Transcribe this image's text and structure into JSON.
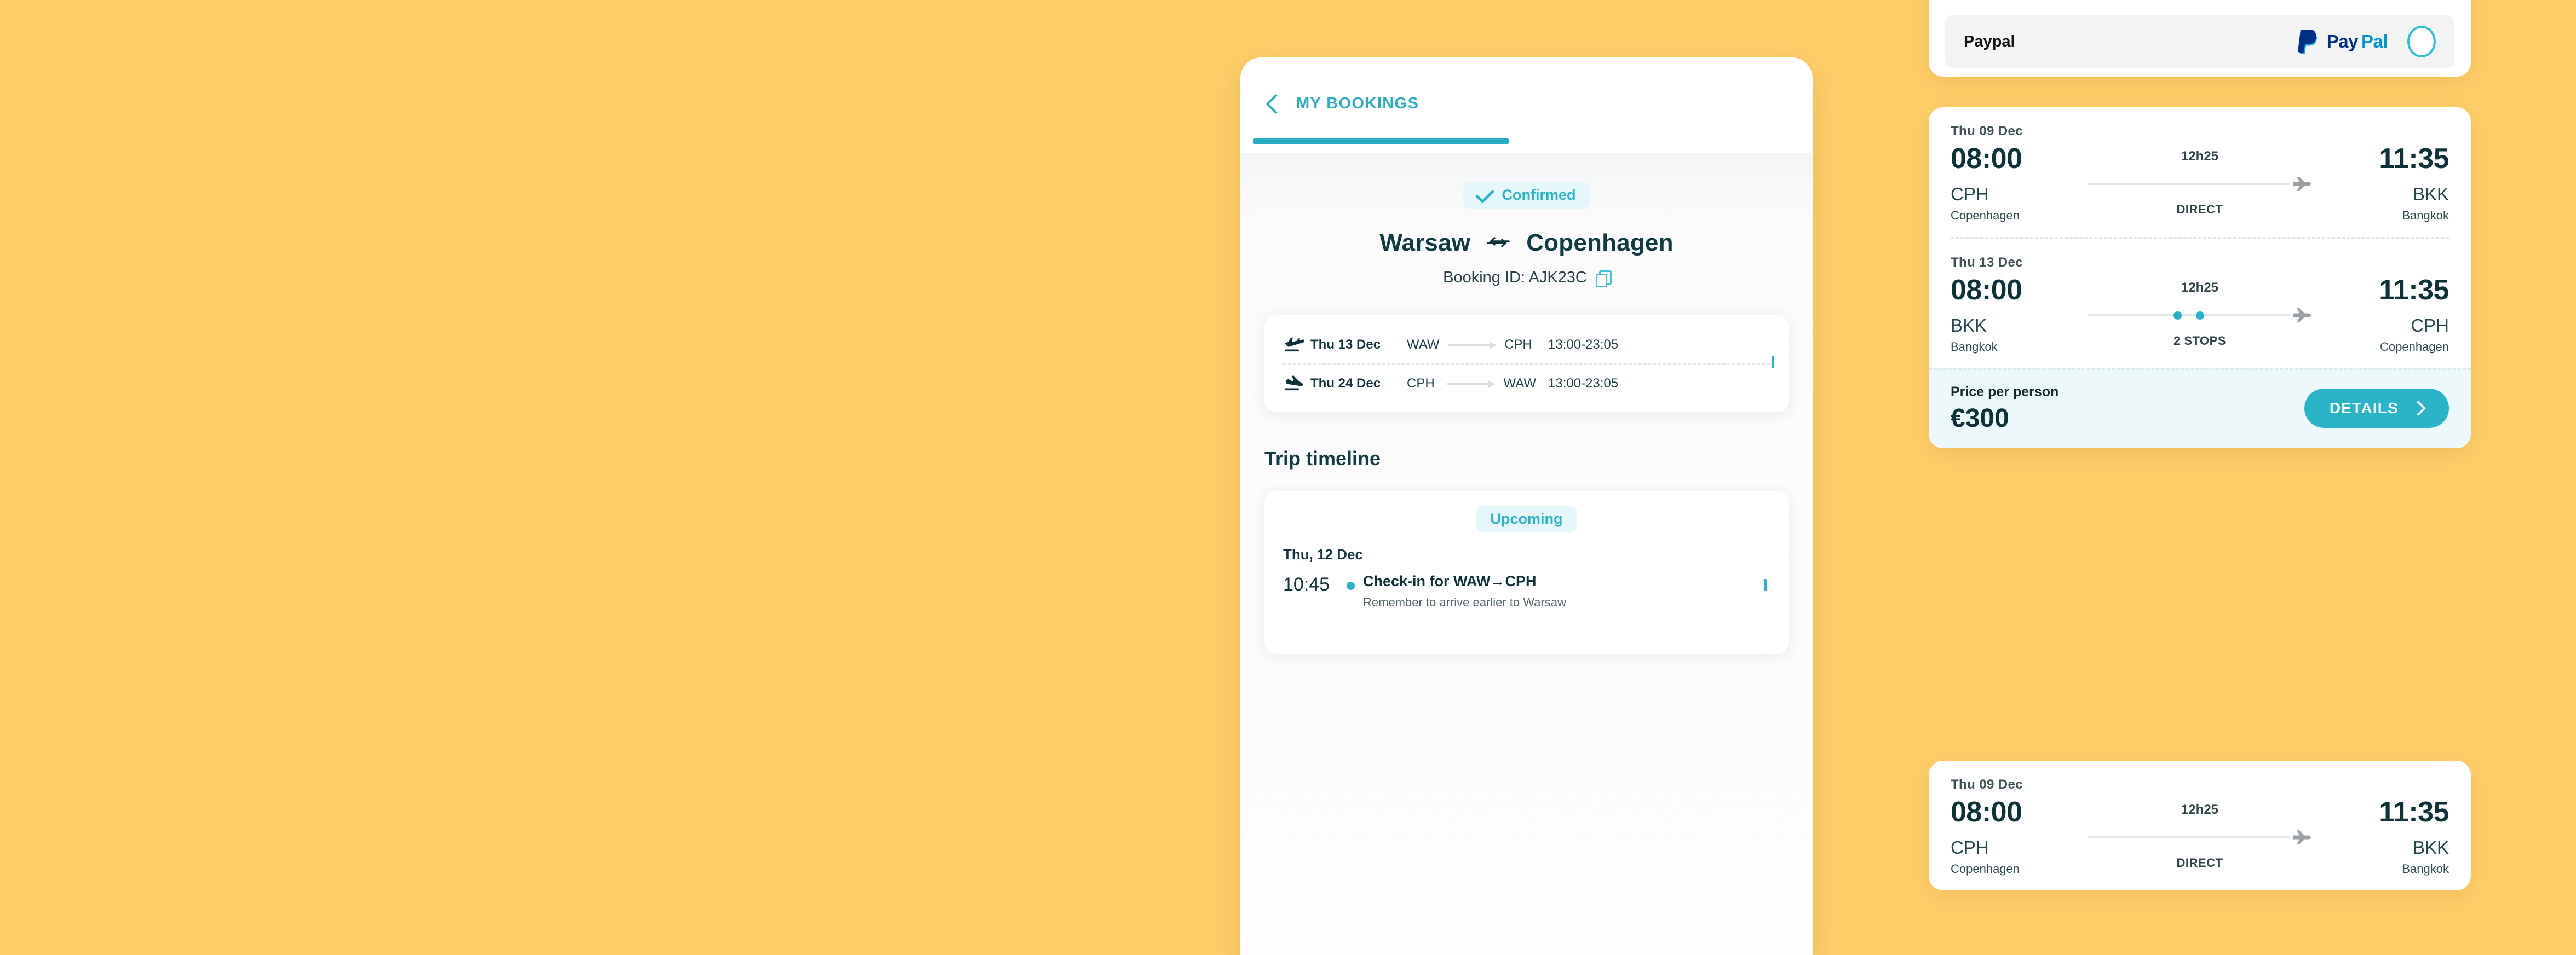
{
  "theme": {
    "background": "#FFCE69",
    "accent_teal": "#29B2C8",
    "dark_text": "#0E3238",
    "pill_bg": "#E6F7FB",
    "price_bar_bg": "#EDF8FA"
  },
  "phone": {
    "header": {
      "back_icon": "chevron-left-icon",
      "title": "MY BOOKINGS"
    },
    "booking": {
      "status_icon": "check-icon",
      "status_label": "Confirmed",
      "origin_city": "Warsaw",
      "swap_icon": "swap-arrows-icon",
      "destination_city": "Copenhagen",
      "booking_id_label": "Booking ID: AJK23C",
      "copy_icon": "copy-icon"
    },
    "legs": [
      {
        "icon": "takeoff-icon",
        "date": "Thu 13 Dec",
        "from": "WAW",
        "to": "CPH",
        "time": "13:00-23:05"
      },
      {
        "icon": "landing-icon",
        "date": "Thu 24 Dec",
        "from": "CPH",
        "to": "WAW",
        "time": "13:00-23:05"
      }
    ],
    "timeline": {
      "section_title": "Trip timeline",
      "badge": "Upcoming",
      "date": "Thu, 12 Dec",
      "events": [
        {
          "time": "10:45",
          "title": "Check-in for WAW→CPH",
          "subtitle": "Remember to arrive earlier to Warsaw"
        }
      ]
    }
  },
  "payment_card": {
    "label": "Paypal",
    "brand_text_pay": "Pay",
    "brand_text_pal": "Pal",
    "brand_icon": "paypal-logo-icon",
    "radio_icon": "radio-unselected-icon"
  },
  "flight_card_1": {
    "segments": [
      {
        "date": "Thu  09 Dec",
        "depart_time": "08:00",
        "depart_code": "CPH",
        "depart_city": "Copenhagen",
        "duration": "12h25",
        "stops_label": "DIRECT",
        "stops_count": 0,
        "arrive_time": "11:35",
        "arrive_code": "BKK",
        "arrive_city": "Bangkok",
        "plane_icon": "plane-icon"
      },
      {
        "date": "Thu 13 Dec",
        "depart_time": "08:00",
        "depart_code": "BKK",
        "depart_city": "Bangkok",
        "duration": "12h25",
        "stops_label": "2 STOPS",
        "stops_count": 2,
        "arrive_time": "11:35",
        "arrive_code": "CPH",
        "arrive_city": "Copenhagen",
        "plane_icon": "plane-icon"
      }
    ],
    "price_label": "Price per person",
    "price_value": "€300",
    "details_button": "DETAILS",
    "details_icon": "chevron-right-icon"
  },
  "flight_card_3": {
    "segments": [
      {
        "date": "Thu  09 Dec",
        "depart_time": "08:00",
        "depart_code": "CPH",
        "depart_city": "Copenhagen",
        "duration": "12h25",
        "stops_label": "DIRECT",
        "stops_count": 0,
        "arrive_time": "11:35",
        "arrive_code": "BKK",
        "arrive_city": "Bangkok",
        "plane_icon": "plane-icon"
      }
    ]
  }
}
